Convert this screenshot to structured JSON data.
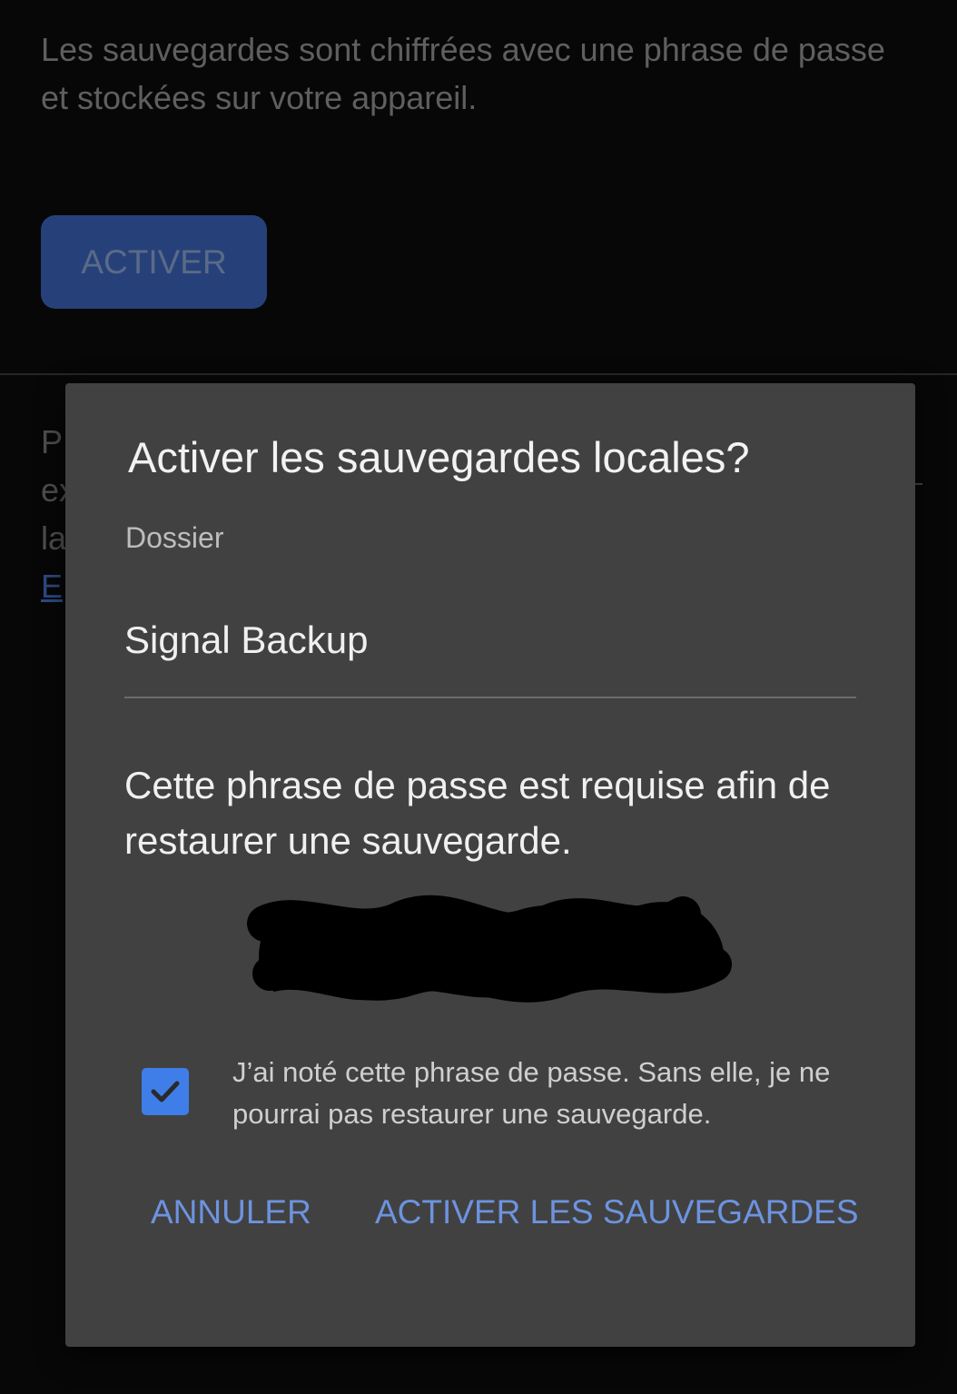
{
  "background": {
    "description": "Les sauvegardes sont chiffrées avec une phrase de passe et stockées sur votre appareil.",
    "enable_label": "ACTIVER",
    "peek_lines": [
      "P",
      "ex",
      "la",
      "E"
    ]
  },
  "dialog": {
    "title": "Activer les sauvegardes locales?",
    "folder_label": "Dossier",
    "folder_value": "Signal Backup",
    "info": "Cette phrase de passe est requise afin de restaurer une sauvegarde.",
    "passphrase": "",
    "checkbox_checked": true,
    "checkbox_label": "J’ai noté cette phrase de passe. Sans elle, je ne pourrai pas restaurer une sauvegarde.",
    "cancel_label": "ANNULER",
    "confirm_label": "ACTIVER LES SAUVEGARDES"
  },
  "colors": {
    "dialog_bg": "#414141",
    "accent": "#6d93e0",
    "checkbox": "#3f7ee8",
    "enable_button": "#26417a"
  },
  "icons": {
    "checkbox": "check-icon"
  }
}
